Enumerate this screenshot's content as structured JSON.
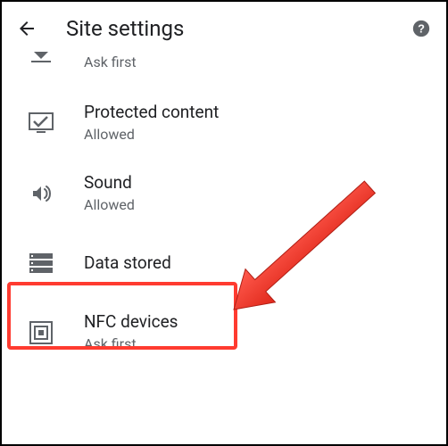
{
  "header": {
    "title": "Site settings"
  },
  "items": [
    {
      "title": "",
      "sub": "Ask first",
      "icon": "download"
    },
    {
      "title": "Protected content",
      "sub": "Allowed",
      "icon": "protected"
    },
    {
      "title": "Sound",
      "sub": "Allowed",
      "icon": "sound"
    },
    {
      "title": "Data stored",
      "sub": "",
      "icon": "data"
    },
    {
      "title": "NFC devices",
      "sub": "Ask first",
      "icon": "nfc"
    }
  ]
}
